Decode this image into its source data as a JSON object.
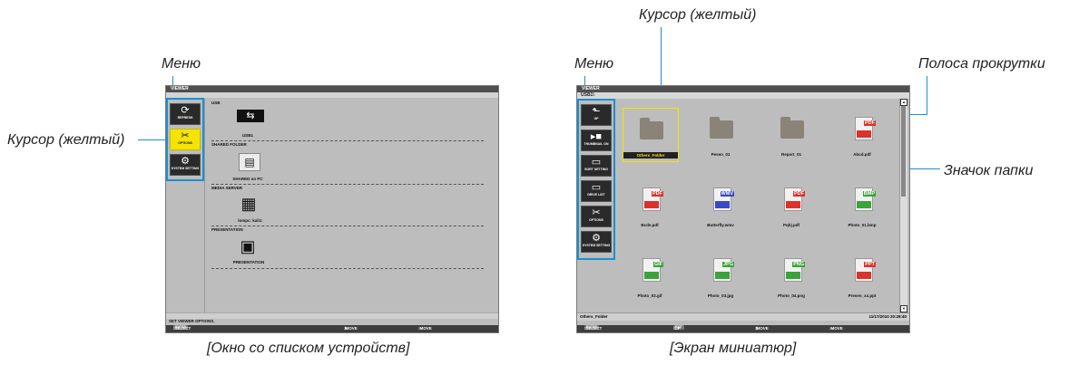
{
  "callouts": {
    "menu": "Меню",
    "cursor": "Курсор (желтый)",
    "scrollbar": "Полоса прокрутки",
    "folder_icon": "Значок папки"
  },
  "captions": {
    "device_list": "[Окно со списком устройств]",
    "thumbnails": "[Экран миниатюр]"
  },
  "device_screen": {
    "title": "VIEWER",
    "menu": [
      {
        "label": "REFRESH",
        "icon": "refresh-icon",
        "glyph": "⟳"
      },
      {
        "label": "OPTIONS",
        "icon": "tools-icon",
        "glyph": "✂"
      },
      {
        "label": "SYSTEM SETTING",
        "icon": "settings-icon",
        "glyph": "⚙"
      }
    ],
    "sections": [
      {
        "header": "USB",
        "device": "USB1",
        "icon": "usb-icon",
        "glyph": "⇆"
      },
      {
        "header": "SHARED FOLDER",
        "device": "SHARED on PC",
        "icon": "network-folder-icon",
        "glyph": "▤"
      },
      {
        "header": "MEDIA SERVER",
        "device": "lompc: kali1:",
        "icon": "media-server-icon",
        "glyph": "▦"
      },
      {
        "header": "PRESENTATION",
        "device": "PRESENTATION",
        "icon": "presentation-icon",
        "glyph": "▣"
      }
    ],
    "status": "SET VIEWER OPTIONS.",
    "footer": {
      "select_key": "ENTER",
      "select": ":SELECT",
      "move1_key": "⇕",
      "move1": ":MOVE",
      "move2_key": "⇔",
      "move2": ":MOVE"
    }
  },
  "thumb_screen": {
    "title": "VIEWER",
    "path": "USB1\\",
    "menu": [
      {
        "label": "UP",
        "icon": "folder-up-icon",
        "glyph": "⬑"
      },
      {
        "label": "THUMBNAIL ON",
        "icon": "thumbnail-toggle-icon",
        "glyph": "▸■"
      },
      {
        "label": "SORT SETTING",
        "icon": "sort-icon",
        "glyph": "▭"
      },
      {
        "label": "DRIVE LIST",
        "icon": "drive-list-icon",
        "glyph": "▭"
      },
      {
        "label": "OPTIONS",
        "icon": "tools-icon",
        "glyph": "✂"
      },
      {
        "label": "SYSTEM SETTING",
        "icon": "settings-icon",
        "glyph": "⚙"
      }
    ],
    "files": [
      {
        "name": "Others_Folder",
        "kind": "folder",
        "tag": "",
        "color": "#8a8377"
      },
      {
        "name": "Pesen_01",
        "kind": "folder",
        "tag": "",
        "color": "#8a8377"
      },
      {
        "name": "Report_01",
        "kind": "folder",
        "tag": "",
        "color": "#8a8377"
      },
      {
        "name": "Abcd.pdf",
        "kind": "doc",
        "tag": "PDF",
        "color": "#d9332b"
      },
      {
        "name": "Bcde.pdf",
        "kind": "doc",
        "tag": "PDF",
        "color": "#d9332b"
      },
      {
        "name": "Butterfly.wmv",
        "kind": "doc",
        "tag": "WMV",
        "color": "#3a49c6"
      },
      {
        "name": "Pqhj.pdf",
        "kind": "doc",
        "tag": "PDF",
        "color": "#d9332b"
      },
      {
        "name": "Photo_01.bmp",
        "kind": "doc",
        "tag": "BMP",
        "color": "#3aa33a"
      },
      {
        "name": "Photo_02.gif",
        "kind": "doc",
        "tag": "GIF",
        "color": "#3aa33a"
      },
      {
        "name": "Photo_03.jpg",
        "kind": "doc",
        "tag": "JPG",
        "color": "#3aa33a"
      },
      {
        "name": "Photo_04.png",
        "kind": "doc",
        "tag": "PNG",
        "color": "#3aa33a"
      },
      {
        "name": "Presen_xx.ppt",
        "kind": "doc",
        "tag": "PPT",
        "color": "#d9332b"
      }
    ],
    "status_left": "Others_Folder",
    "status_right": "11/17/2010 20:28:40",
    "footer": {
      "select_key": "ENTER",
      "select": ":SELECT",
      "up_key": "EXIT",
      "up": ":UP FOLDER",
      "move1_key": "⇕",
      "move1": ":MOVE",
      "move2_key": "⇔",
      "move2": ":MOVE"
    }
  }
}
